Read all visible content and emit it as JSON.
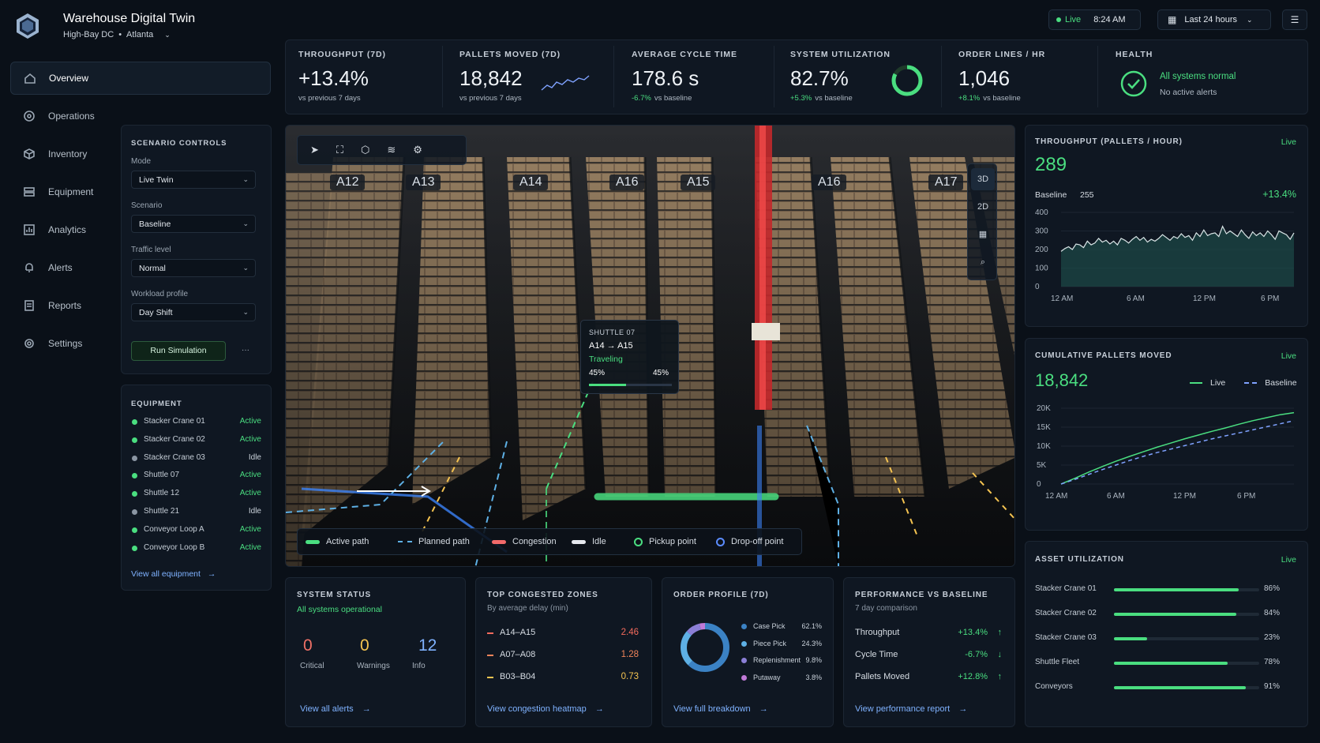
{
  "app": {
    "title": "Warehouse Digital Twin",
    "site": "High-Bay DC",
    "city": "Atlanta"
  },
  "topbar": {
    "live": "Live",
    "time": "8:24 AM",
    "range": "Last 24 hours"
  },
  "nav": [
    {
      "label": "Overview",
      "icon": "home-icon",
      "active": true
    },
    {
      "label": "Operations",
      "icon": "operations-icon"
    },
    {
      "label": "Inventory",
      "icon": "box-icon"
    },
    {
      "label": "Equipment",
      "icon": "equipment-icon"
    },
    {
      "label": "Analytics",
      "icon": "analytics-icon"
    },
    {
      "label": "Alerts",
      "icon": "bell-icon"
    },
    {
      "label": "Reports",
      "icon": "report-icon"
    },
    {
      "label": "Settings",
      "icon": "gear-icon"
    }
  ],
  "kpis": [
    {
      "label": "THROUGHPUT (7D)",
      "value": "+13.4%",
      "sub": "vs previous 7 days",
      "green": true
    },
    {
      "label": "PALLETS MOVED (7D)",
      "value": "18,842",
      "sub": "vs previous 7 days"
    },
    {
      "label": "AVERAGE CYCLE TIME",
      "value": "178.6 s",
      "delta": "-6.7%",
      "sub": "vs baseline"
    },
    {
      "label": "SYSTEM UTILIZATION",
      "value": "82.7%",
      "delta": "+5.3%",
      "sub": "vs baseline",
      "gauge": 0.827
    },
    {
      "label": "ORDER LINES / HR",
      "value": "1,046",
      "delta": "+8.1%",
      "sub": "vs baseline",
      "green": true
    },
    {
      "label": "HEALTH",
      "value": "All systems normal",
      "sub": "No active alerts"
    }
  ],
  "scenario": {
    "title": "SCENARIO CONTROLS",
    "fields": [
      {
        "label": "Mode",
        "value": "Live Twin"
      },
      {
        "label": "Scenario",
        "value": "Baseline"
      },
      {
        "label": "Traffic level",
        "value": "Normal"
      },
      {
        "label": "Workload profile",
        "value": "Day Shift"
      }
    ],
    "run": "Run Simulation",
    "more": "···"
  },
  "equipment": {
    "title": "EQUIPMENT",
    "items": [
      {
        "name": "Stacker Crane 01",
        "status": "Active"
      },
      {
        "name": "Stacker Crane 02",
        "status": "Active"
      },
      {
        "name": "Stacker Crane 03",
        "status": "Idle"
      },
      {
        "name": "Shuttle 07",
        "status": "Active"
      },
      {
        "name": "Shuttle 12",
        "status": "Active"
      },
      {
        "name": "Shuttle 21",
        "status": "Idle"
      },
      {
        "name": "Conveyor Loop A",
        "status": "Active"
      },
      {
        "name": "Conveyor Loop B",
        "status": "Active"
      }
    ],
    "link": "View all equipment"
  },
  "viewport": {
    "aisles": [
      "A12",
      "A13",
      "A14",
      "A16",
      "A15",
      "A16",
      "A17"
    ],
    "views": [
      "3D",
      "2D"
    ],
    "tooltip": {
      "title": "SHUTTLE 07",
      "route": "A14 → A15",
      "state": "Traveling",
      "left": "45%",
      "right": "45%",
      "progress": 0.45
    },
    "legend": [
      "Active path",
      "Planned path",
      "Congestion",
      "Idle",
      "Pickup point",
      "Drop-off point"
    ]
  },
  "throughput_chart": {
    "title": "THROUGHPUT (PALLETS / HOUR)",
    "live": "Live",
    "value": "289",
    "baseline_label": "Baseline",
    "baseline_value": "255",
    "delta": "+13.4%"
  },
  "cumulative_chart": {
    "title": "CUMULATIVE PALLETS MOVED",
    "live": "Live",
    "value": "18,842",
    "legend_live": "Live",
    "legend_baseline": "Baseline"
  },
  "chart_data": [
    {
      "type": "area",
      "title": "THROUGHPUT (PALLETS / HOUR)",
      "x": [
        "12 AM",
        "6 AM",
        "12 PM",
        "6 PM"
      ],
      "ylim": [
        0,
        400
      ],
      "yticks": [
        0,
        100,
        200,
        300,
        400
      ],
      "series": [
        {
          "values": [
            190,
            205,
            215,
            200,
            230,
            225,
            210,
            245,
            225,
            235,
            260,
            240,
            250,
            230,
            245,
            225,
            260,
            250,
            235,
            255,
            270,
            250,
            265,
            240,
            255,
            245,
            260,
            280,
            265,
            250,
            270,
            260,
            285,
            265,
            275,
            250,
            290,
            270,
            305,
            275,
            285,
            290,
            270,
            325,
            285,
            300,
            285,
            270,
            305,
            280,
            260,
            295,
            275,
            290,
            270,
            300,
            280,
            255,
            300,
            290,
            280,
            255,
            290
          ]
        }
      ]
    },
    {
      "type": "line",
      "title": "CUMULATIVE PALLETS MOVED",
      "x": [
        "12 AM",
        "6 AM",
        "12 PM",
        "6 PM"
      ],
      "ylim": [
        0,
        20000
      ],
      "yticks": [
        "0",
        "5K",
        "10K",
        "15K",
        "20K"
      ],
      "series": [
        {
          "name": "Live",
          "values": [
            0,
            1500,
            3100,
            4600,
            6000,
            7300,
            8500,
            9700,
            10800,
            11900,
            12900,
            13900,
            14800,
            15800,
            16700,
            17500,
            18300,
            18842
          ]
        },
        {
          "name": "Baseline",
          "values": [
            0,
            1200,
            2500,
            3800,
            5000,
            6200,
            7300,
            8300,
            9200,
            10100,
            11000,
            11900,
            12700,
            13500,
            14300,
            15100,
            15900,
            16700
          ]
        }
      ]
    }
  ],
  "asset_util": {
    "title": "ASSET UTILIZATION",
    "live": "Live",
    "items": [
      {
        "name": "Stacker Crane 01",
        "pct": "86%",
        "v": 0.86
      },
      {
        "name": "Stacker Crane 02",
        "pct": "84%",
        "v": 0.84
      },
      {
        "name": "Stacker Crane 03",
        "pct": "23%",
        "v": 0.23
      },
      {
        "name": "Shuttle Fleet",
        "pct": "78%",
        "v": 0.78
      },
      {
        "name": "Conveyors",
        "pct": "91%",
        "v": 0.91
      }
    ]
  },
  "system_status": {
    "title": "SYSTEM STATUS",
    "sub": "All systems operational",
    "counts": [
      {
        "value": "0",
        "label": "Critical",
        "color": "#f07167"
      },
      {
        "value": "0",
        "label": "Warnings",
        "color": "#f5c451"
      },
      {
        "value": "12",
        "label": "Info",
        "color": "#7fb2ff"
      }
    ],
    "link": "View all alerts"
  },
  "congested": {
    "title": "TOP CONGESTED ZONES",
    "sub": "By average delay (min)",
    "items": [
      {
        "zone": "A14–A15",
        "value": "2.46",
        "color": "#f26a5c"
      },
      {
        "zone": "A07–A08",
        "value": "1.28",
        "color": "#f0845a"
      },
      {
        "zone": "B03–B04",
        "value": "0.73",
        "color": "#f5c451"
      }
    ],
    "link": "View congestion heatmap"
  },
  "order_profile": {
    "title": "ORDER PROFILE (7D)",
    "items": [
      {
        "name": "Case Pick",
        "pct": "62.1%",
        "v": 62.1,
        "color": "#3b82c4"
      },
      {
        "name": "Piece Pick",
        "pct": "24.3%",
        "v": 24.3,
        "color": "#5eb0e5"
      },
      {
        "name": "Replenishment",
        "pct": "9.8%",
        "v": 9.8,
        "color": "#8b7fd6"
      },
      {
        "name": "Putaway",
        "pct": "3.8%",
        "v": 3.8,
        "color": "#c07ad8"
      }
    ],
    "link": "View full breakdown"
  },
  "performance": {
    "title": "PERFORMANCE VS BASELINE",
    "sub": "7 day comparison",
    "items": [
      {
        "name": "Throughput",
        "value": "+13.4%",
        "arrow": "↑",
        "color": "#4ade80"
      },
      {
        "name": "Cycle Time",
        "value": "-6.7%",
        "arrow": "↓",
        "color": "#4ade80"
      },
      {
        "name": "Pallets Moved",
        "value": "+12.8%",
        "arrow": "↑",
        "color": "#4ade80"
      }
    ],
    "link": "View performance report"
  }
}
